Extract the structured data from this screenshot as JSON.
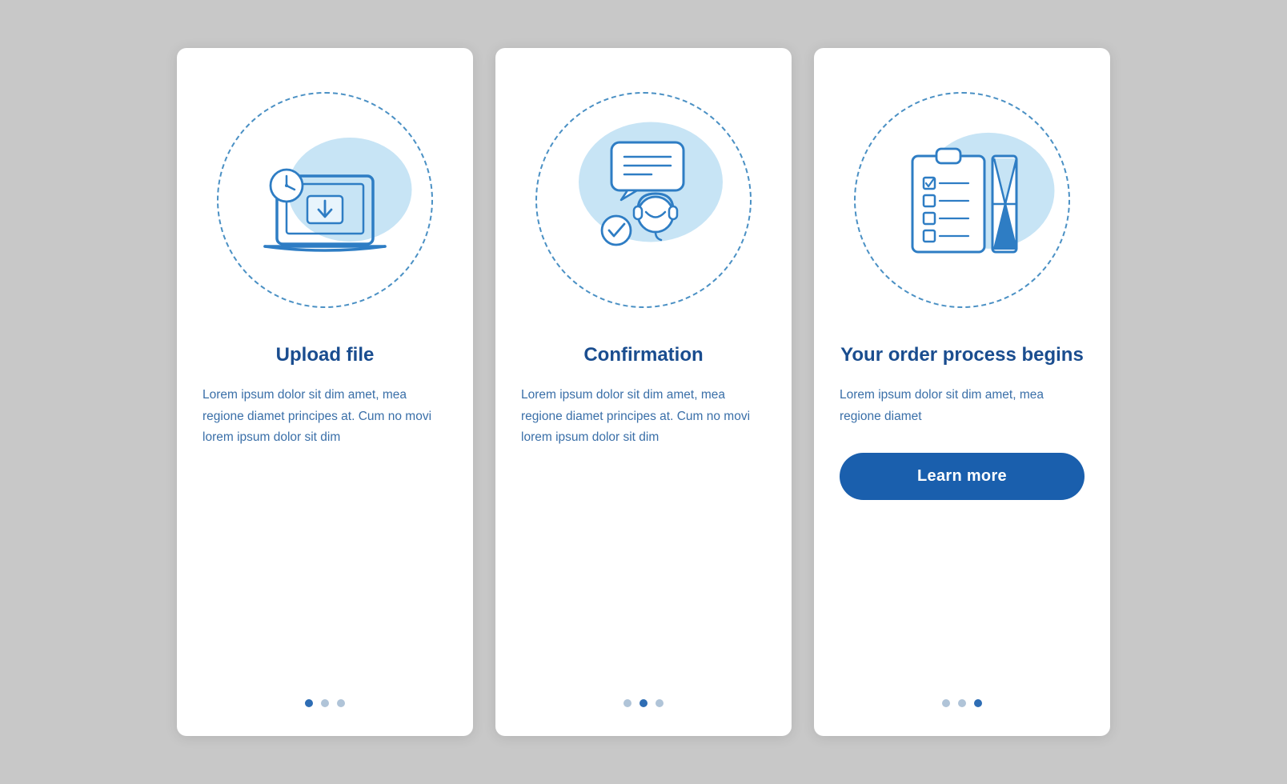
{
  "cards": [
    {
      "id": "upload-file",
      "title": "Upload file",
      "text": "Lorem ipsum dolor sit dim amet, mea regione diamet principes at. Cum no movi lorem ipsum dolor sit dim",
      "dots": [
        true,
        false,
        false
      ],
      "hasButton": false,
      "icon": "upload"
    },
    {
      "id": "confirmation",
      "title": "Confirmation",
      "text": "Lorem ipsum dolor sit dim amet, mea regione diamet principes at. Cum no movi lorem ipsum dolor sit dim",
      "dots": [
        false,
        true,
        false
      ],
      "hasButton": false,
      "icon": "headset"
    },
    {
      "id": "order-process",
      "title": "Your order process begins",
      "text": "Lorem ipsum dolor sit dim amet, mea regione diamet",
      "dots": [
        false,
        false,
        true
      ],
      "hasButton": true,
      "buttonLabel": "Learn more",
      "icon": "checklist"
    }
  ]
}
